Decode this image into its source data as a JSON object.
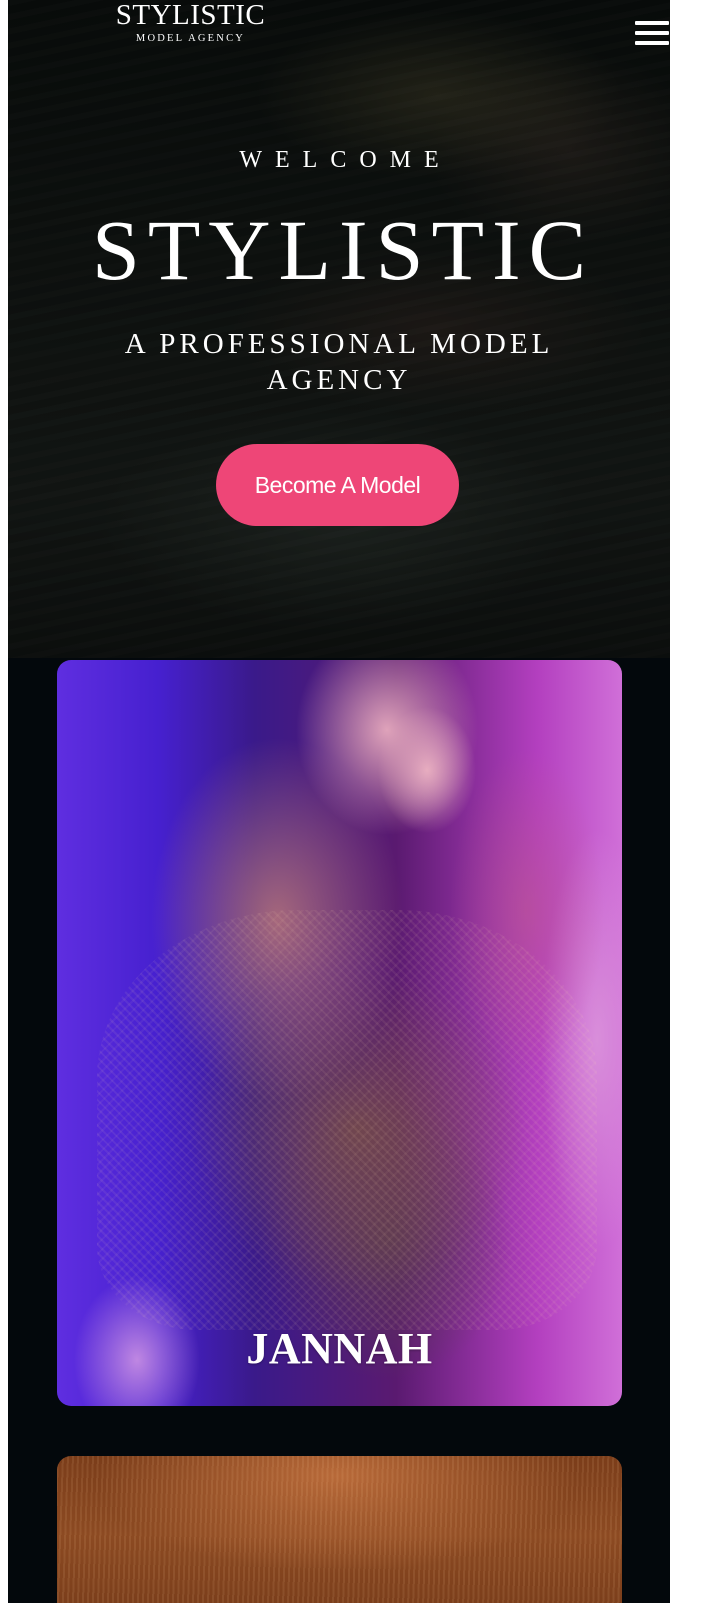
{
  "header": {
    "logo_title": "STYLISTIC",
    "logo_subtitle": "MODEL AGENCY"
  },
  "hero": {
    "eyebrow": "WELCOME",
    "title": "STYLISTIC",
    "subtitle": "A PROFESSIONAL MODEL AGENCY",
    "cta_label": "Become A Model"
  },
  "models": [
    {
      "name": "JANNAH"
    },
    {
      "name": ""
    }
  ],
  "colors": {
    "page_background": "#03080c",
    "cta_background": "#ee4677",
    "text": "#ffffff"
  },
  "icons": {
    "menu": "hamburger-menu-icon"
  }
}
